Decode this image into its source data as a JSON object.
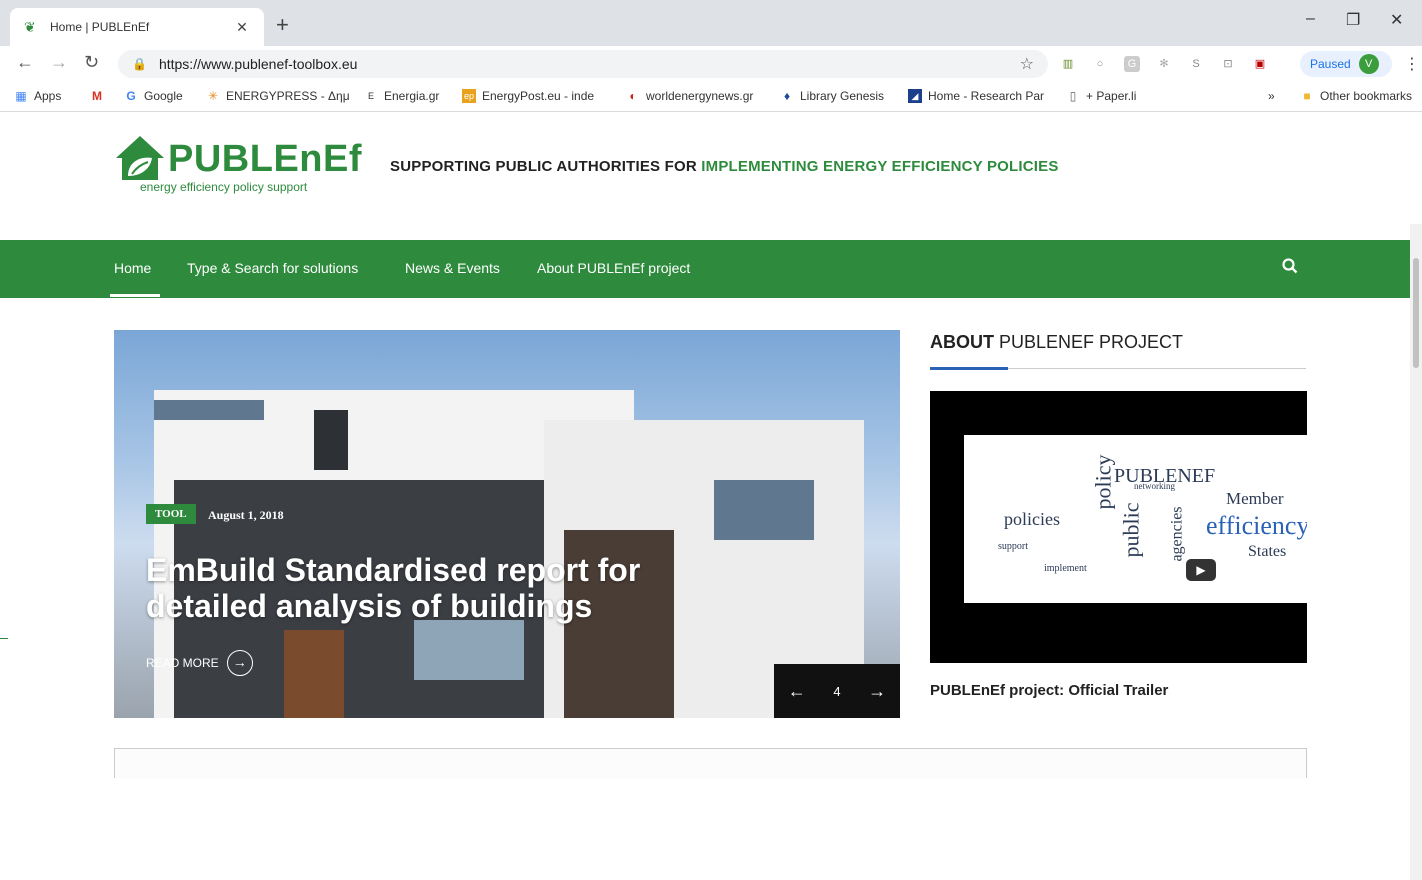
{
  "browser": {
    "tab_title": "Home | PUBLEnEf",
    "url": "https://www.publenef-toolbox.eu",
    "profile_status": "Paused",
    "profile_initial": "V",
    "bookmarks": [
      {
        "label": "Apps"
      },
      {
        "label": ""
      },
      {
        "label": "Google"
      },
      {
        "label": "ENERGYPRESS - Δημ"
      },
      {
        "label": "Energia.gr"
      },
      {
        "label": "EnergyPost.eu - inde"
      },
      {
        "label": "worldenergynews.gr"
      },
      {
        "label": "Library Genesis"
      },
      {
        "label": "Home - Research Par"
      },
      {
        "label": "+ Paper.li"
      }
    ],
    "bookmarks_more": "»",
    "other_bookmarks": "Other bookmarks"
  },
  "site": {
    "logo_text": "PUBLEnEf",
    "logo_sub": "energy efficiency policy support",
    "tagline_plain": "SUPPORTING PUBLIC AUTHORITIES FOR ",
    "tagline_green": "IMPLEMENTING ENERGY EFFICIENCY POLICIES",
    "nav": [
      {
        "label": "Home"
      },
      {
        "label": "Type & Search for solutions"
      },
      {
        "label": "News & Events"
      },
      {
        "label": "About PUBLEnEf project"
      }
    ],
    "hero": {
      "badge": "TOOL",
      "date": "August 1, 2018",
      "title": "EmBuild Standardised report for detailed analysis of buildings",
      "read_more": "READ MORE",
      "slide_number": "4"
    },
    "about": {
      "title_bold": "ABOUT",
      "title_rest": " PUBLENEF PROJECT",
      "video_caption": "PUBLEnEf project: Official Trailer",
      "cloud_words": [
        "PUBLENEF",
        "policy",
        "policies",
        "Member",
        "efficiency",
        "States",
        "public",
        "agencies",
        "networking",
        "support",
        "implement"
      ]
    }
  },
  "colors": {
    "brand_green": "#2e8b3d",
    "accent_blue": "#2a62b5"
  }
}
